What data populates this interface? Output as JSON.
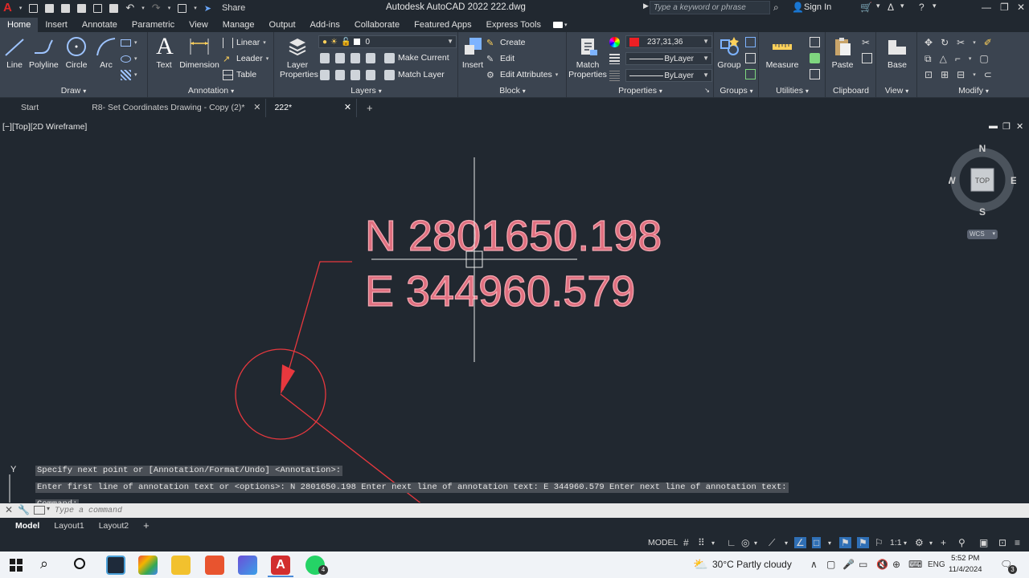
{
  "titlebar": {
    "title": "Autodesk AutoCAD 2022    222.dwg",
    "share": "Share",
    "search_placeholder": "Type a keyword or phrase",
    "sign_in": "Sign In"
  },
  "menu_tabs": [
    "Home",
    "Insert",
    "Annotate",
    "Parametric",
    "View",
    "Manage",
    "Output",
    "Add-ins",
    "Collaborate",
    "Featured Apps",
    "Express Tools"
  ],
  "ribbon": {
    "draw": {
      "title": "Draw",
      "tools": [
        "Line",
        "Polyline",
        "Circle",
        "Arc"
      ]
    },
    "annotation": {
      "title": "Annotation",
      "text": "Text",
      "dimension": "Dimension",
      "linear": "Linear",
      "leader": "Leader",
      "table": "Table"
    },
    "layers": {
      "title": "Layers",
      "layer_properties": "Layer Properties",
      "layer_value": "0",
      "make_current": "Make Current",
      "match_layer": "Match Layer"
    },
    "block": {
      "title": "Block",
      "insert": "Insert",
      "create": "Create",
      "edit": "Edit",
      "edit_attributes": "Edit Attributes"
    },
    "properties": {
      "title": "Properties",
      "match_properties": "Match Properties",
      "color_value": "237,31,36",
      "linetype": "ByLayer",
      "lineweight": "ByLayer",
      "color_swatch": "#ed1f24"
    },
    "groups": {
      "title": "Groups",
      "group": "Group"
    },
    "utilities": {
      "title": "Utilities",
      "measure": "Measure"
    },
    "clipboard": {
      "title": "Clipboard",
      "paste": "Paste"
    },
    "view": {
      "title": "View",
      "base": "Base"
    },
    "modify": {
      "title": "Modify"
    }
  },
  "doc_tabs": [
    "Start",
    "R8- Set Coordinates Drawing - Copy (2)*",
    "222*"
  ],
  "viewport": {
    "label": "[−][Top][2D Wireframe]",
    "north_text": "N 2801650.198",
    "east_text": "E 344960.579",
    "compass": {
      "n": "N",
      "s": "S",
      "e": "E",
      "w": "W",
      "top": "TOP",
      "wcs": "WCS"
    },
    "ucs_label": "Y"
  },
  "command": {
    "history": [
      "Specify next point or [Annotation/Format/Undo] <Annotation>:",
      "Enter first line of annotation text or <options>: N 2801650.198 Enter next line of annotation text: E 344960.579 Enter next line of annotation text:",
      "Command:"
    ],
    "placeholder": "Type a command"
  },
  "layout_tabs": [
    "Model",
    "Layout1",
    "Layout2"
  ],
  "status": {
    "model": "MODEL",
    "scale": "1:1"
  },
  "taskbar": {
    "weather": "30°C  Partly cloudy",
    "lang": "ENG",
    "time": "5:52 PM",
    "date": "11/4/2024",
    "whatsapp_badge": "4",
    "notif_badge": "3"
  }
}
